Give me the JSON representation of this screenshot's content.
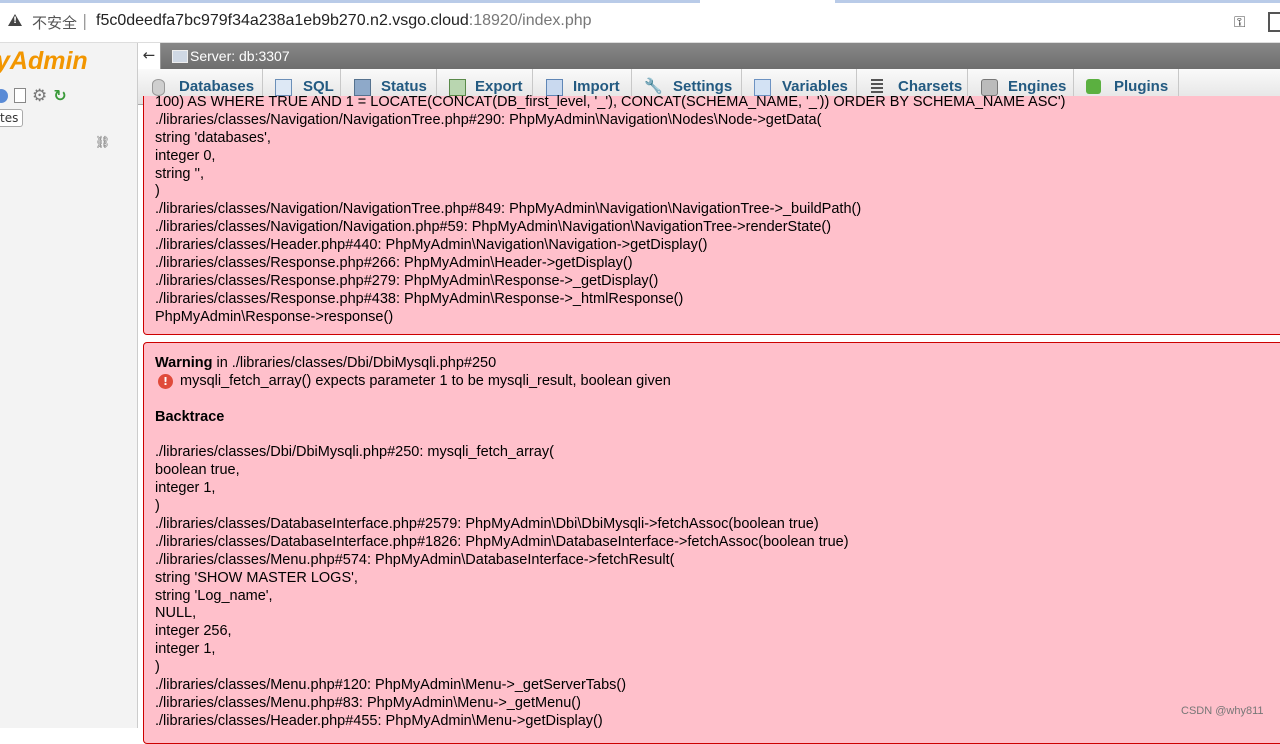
{
  "browser": {
    "insecure_label": "不安全",
    "separator": "|",
    "url_host": "f5c0deedfa7bc979f34a238a1eb9b270.n2.vsgo.cloud",
    "url_port_path": ":18920/index.php"
  },
  "nav": {
    "logo_text": "yAdmin",
    "tab_label": "tes"
  },
  "serverbar": {
    "back_label": "←",
    "server_label": "Server: db:3307"
  },
  "tabs": [
    {
      "label": "Databases",
      "icon": "database-icon"
    },
    {
      "label": "SQL",
      "icon": "sql-icon"
    },
    {
      "label": "Status",
      "icon": "status-icon"
    },
    {
      "label": "Export",
      "icon": "export-icon"
    },
    {
      "label": "Import",
      "icon": "import-icon"
    },
    {
      "label": "Settings",
      "icon": "wrench-icon"
    },
    {
      "label": "Variables",
      "icon": "variables-icon"
    },
    {
      "label": "Charsets",
      "icon": "charsets-icon"
    },
    {
      "label": "Engines",
      "icon": "engines-icon"
    },
    {
      "label": "Plugins",
      "icon": "puzzle-icon"
    }
  ],
  "error1": {
    "lines": [
      "100) AS WHERE TRUE AND 1 = LOCATE(CONCAT(DB_first_level, '_'), CONCAT(SCHEMA_NAME, '_')) ORDER BY SCHEMA_NAME ASC')",
      "./libraries/classes/Navigation/NavigationTree.php#290: PhpMyAdmin\\Navigation\\Nodes\\Node->getData(",
      "string 'databases',",
      "integer 0,",
      "string '',",
      ")",
      "./libraries/classes/Navigation/NavigationTree.php#849: PhpMyAdmin\\Navigation\\NavigationTree->_buildPath()",
      "./libraries/classes/Navigation/Navigation.php#59: PhpMyAdmin\\Navigation\\NavigationTree->renderState()",
      "./libraries/classes/Header.php#440: PhpMyAdmin\\Navigation\\Navigation->getDisplay()",
      "./libraries/classes/Response.php#266: PhpMyAdmin\\Header->getDisplay()",
      "./libraries/classes/Response.php#279: PhpMyAdmin\\Response->_getDisplay()",
      "./libraries/classes/Response.php#438: PhpMyAdmin\\Response->_htmlResponse()",
      "PhpMyAdmin\\Response->response()"
    ]
  },
  "error2": {
    "warning_word": "Warning",
    "warning_loc": " in ./libraries/classes/Dbi/DbiMysqli.php#250",
    "message": "mysqli_fetch_array() expects parameter 1 to be mysqli_result, boolean given",
    "backtrace_title": "Backtrace",
    "lines": [
      "./libraries/classes/Dbi/DbiMysqli.php#250: mysqli_fetch_array(",
      "boolean true,",
      "integer 1,",
      ")",
      "./libraries/classes/DatabaseInterface.php#2579: PhpMyAdmin\\Dbi\\DbiMysqli->fetchAssoc(boolean true)",
      "./libraries/classes/DatabaseInterface.php#1826: PhpMyAdmin\\DatabaseInterface->fetchAssoc(boolean true)",
      "./libraries/classes/Menu.php#574: PhpMyAdmin\\DatabaseInterface->fetchResult(",
      "string 'SHOW MASTER LOGS',",
      "string 'Log_name',",
      "NULL,",
      "integer 256,",
      "integer 1,",
      ")",
      "./libraries/classes/Menu.php#120: PhpMyAdmin\\Menu->_getServerTabs()",
      "./libraries/classes/Menu.php#83: PhpMyAdmin\\Menu->_getMenu()",
      "./libraries/classes/Header.php#455: PhpMyAdmin\\Menu->getDisplay()"
    ]
  },
  "watermark": "CSDN @why811"
}
